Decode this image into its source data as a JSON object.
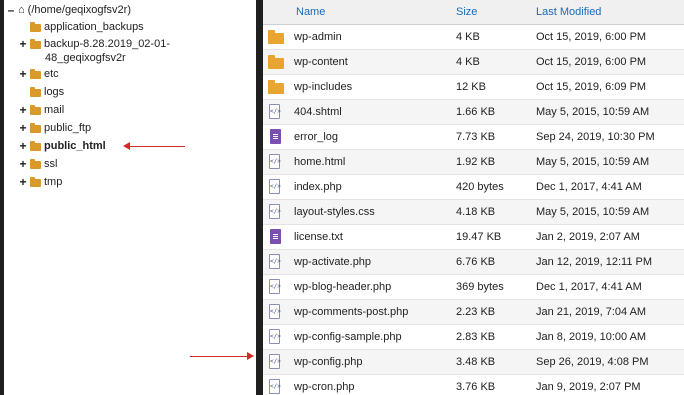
{
  "tree": {
    "root_label": "(/home/geqixogfsv2r)",
    "items": [
      {
        "label": "application_backups",
        "toggle": ""
      },
      {
        "label": "backup-8.28.2019_02-01-",
        "label2": "48_geqixogfsv2r",
        "toggle": "+"
      },
      {
        "label": "etc",
        "toggle": "+"
      },
      {
        "label": "logs",
        "toggle": ""
      },
      {
        "label": "mail",
        "toggle": "+"
      },
      {
        "label": "public_ftp",
        "toggle": "+"
      },
      {
        "label": "public_html",
        "toggle": "+",
        "selected": true
      },
      {
        "label": "ssl",
        "toggle": "+"
      },
      {
        "label": "tmp",
        "toggle": "+"
      }
    ]
  },
  "table": {
    "headers": {
      "name": "Name",
      "size": "Size",
      "modified": "Last Modified"
    },
    "rows": [
      {
        "name": "wp-admin",
        "size": "4 KB",
        "modified": "Oct 15, 2019, 6:00 PM",
        "icon": "folder-icon"
      },
      {
        "name": "wp-content",
        "size": "4 KB",
        "modified": "Oct 15, 2019, 6:00 PM",
        "icon": "folder-icon"
      },
      {
        "name": "wp-includes",
        "size": "12 KB",
        "modified": "Oct 15, 2019, 6:09 PM",
        "icon": "folder-icon"
      },
      {
        "name": "404.shtml",
        "size": "1.66 KB",
        "modified": "May 5, 2015, 10:59 AM",
        "icon": "code-file-icon"
      },
      {
        "name": "error_log",
        "size": "7.73 KB",
        "modified": "Sep 24, 2019, 10:30 PM",
        "icon": "text-file-icon"
      },
      {
        "name": "home.html",
        "size": "1.92 KB",
        "modified": "May 5, 2015, 10:59 AM",
        "icon": "code-file-icon"
      },
      {
        "name": "index.php",
        "size": "420 bytes",
        "modified": "Dec 1, 2017, 4:41 AM",
        "icon": "code-file-icon"
      },
      {
        "name": "layout-styles.css",
        "size": "4.18 KB",
        "modified": "May 5, 2015, 10:59 AM",
        "icon": "code-file-icon"
      },
      {
        "name": "license.txt",
        "size": "19.47 KB",
        "modified": "Jan 2, 2019, 2:07 AM",
        "icon": "text-file-icon"
      },
      {
        "name": "wp-activate.php",
        "size": "6.76 KB",
        "modified": "Jan 12, 2019, 12:11 PM",
        "icon": "code-file-icon"
      },
      {
        "name": "wp-blog-header.php",
        "size": "369 bytes",
        "modified": "Dec 1, 2017, 4:41 AM",
        "icon": "code-file-icon"
      },
      {
        "name": "wp-comments-post.php",
        "size": "2.23 KB",
        "modified": "Jan 21, 2019, 7:04 AM",
        "icon": "code-file-icon"
      },
      {
        "name": "wp-config-sample.php",
        "size": "2.83 KB",
        "modified": "Jan 8, 2019, 10:00 AM",
        "icon": "code-file-icon"
      },
      {
        "name": "wp-config.php",
        "size": "3.48 KB",
        "modified": "Sep 26, 2019, 4:08 PM",
        "icon": "code-file-icon"
      },
      {
        "name": "wp-cron.php",
        "size": "3.76 KB",
        "modified": "Jan 9, 2019, 2:07 PM",
        "icon": "code-file-icon"
      }
    ]
  },
  "colors": {
    "accent": "#1a6ab8",
    "folder": "#e8a531",
    "text_file": "#7b4fb0",
    "arrow": "#d62828"
  }
}
